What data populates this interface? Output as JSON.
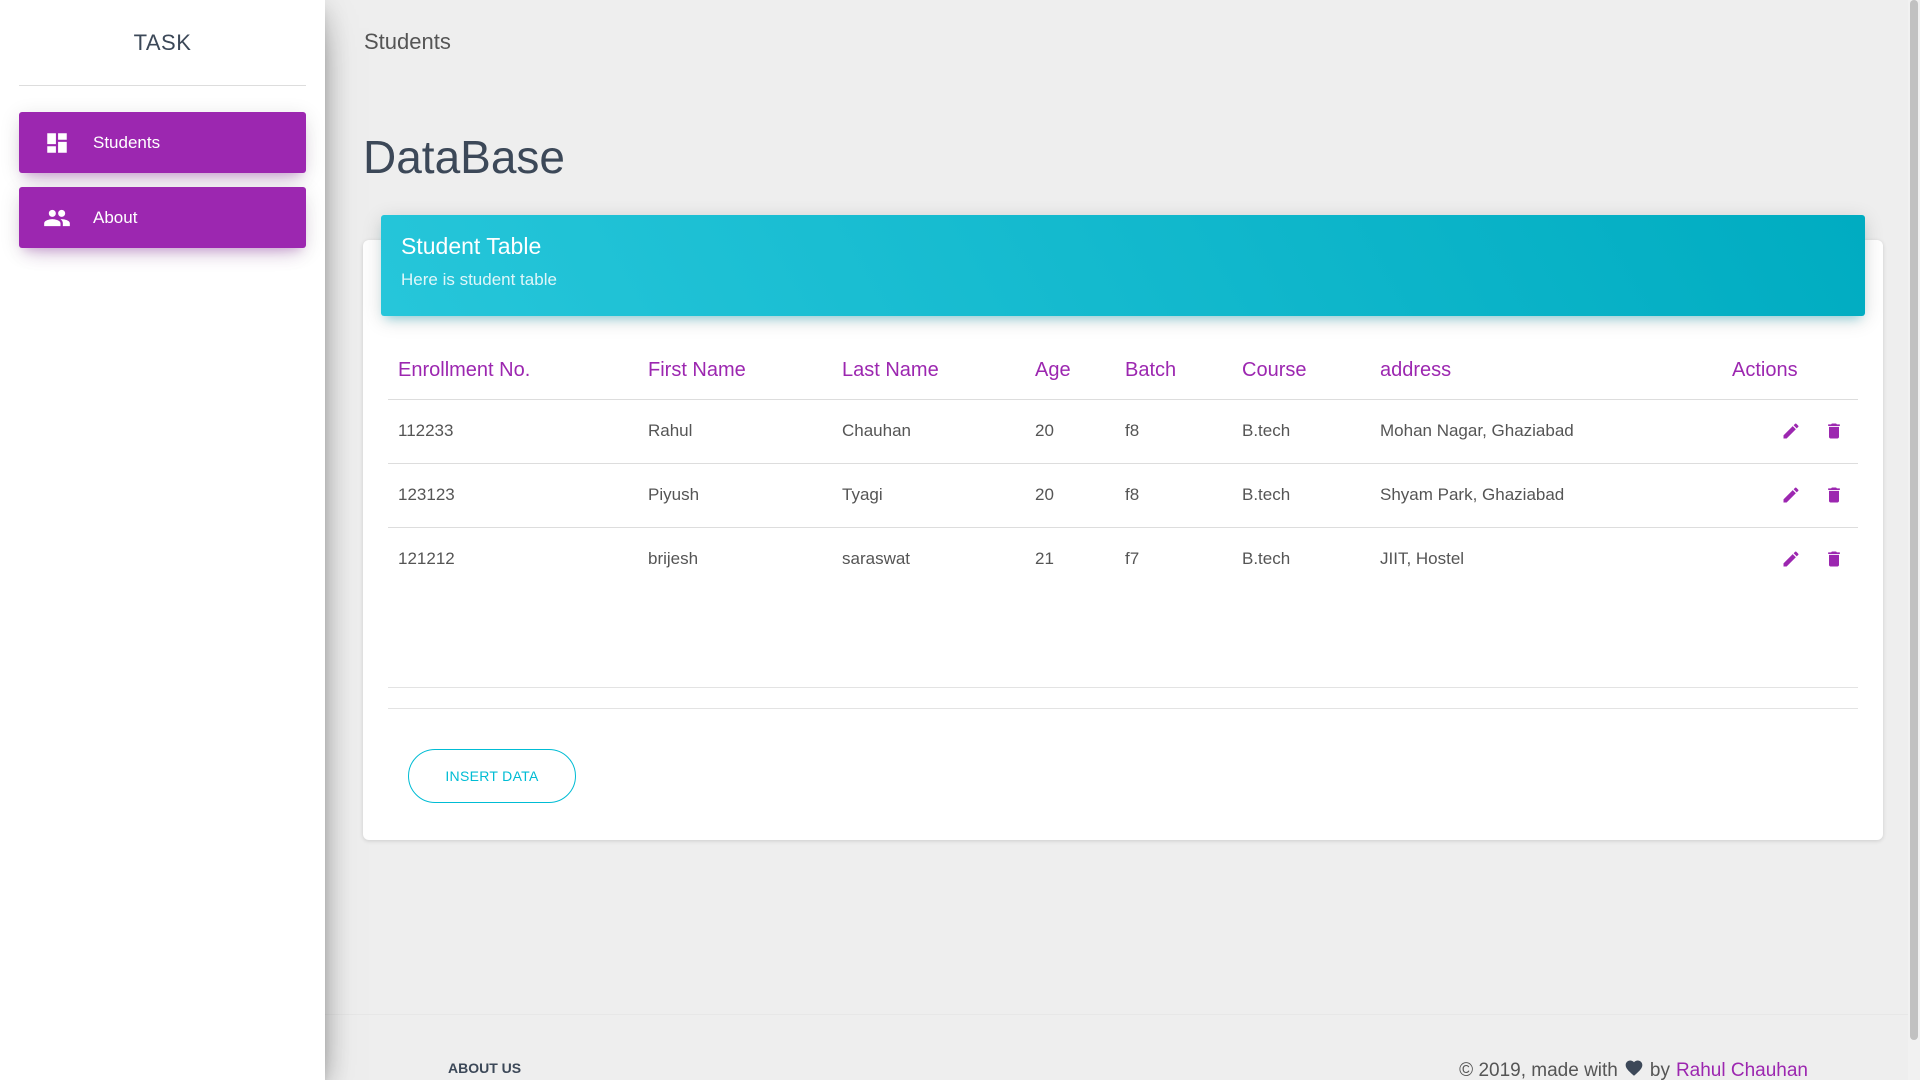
{
  "sidebar": {
    "brand": "TASK",
    "items": [
      {
        "label": "Students",
        "icon": "dashboard-icon"
      },
      {
        "label": "About",
        "icon": "people-icon"
      }
    ]
  },
  "topbar": {
    "title": "Students"
  },
  "page": {
    "title": "DataBase"
  },
  "card": {
    "title": "Student Table",
    "subtitle": "Here is student table",
    "insert_label": "INSERT DATA"
  },
  "table": {
    "headers": [
      "Enrollment No.",
      "First Name",
      "Last Name",
      "Age",
      "Batch",
      "Course",
      "address",
      "Actions"
    ],
    "rows": [
      [
        "112233",
        "Rahul",
        "Chauhan",
        "20",
        "f8",
        "B.tech",
        "Mohan Nagar, Ghaziabad"
      ],
      [
        "123123",
        "Piyush",
        "Tyagi",
        "20",
        "f8",
        "B.tech",
        "Shyam Park, Ghaziabad"
      ],
      [
        "121212",
        "brijesh",
        "saraswat",
        "21",
        "f7",
        "B.tech",
        "JIIT, Hostel"
      ]
    ]
  },
  "footer": {
    "link": "ABOUT US",
    "copyright_prefix": "© 2019, made with",
    "copyright_by": "by",
    "author": "Rahul Chauhan"
  },
  "colors": {
    "primary": "#9c27b0",
    "info": "#00bcd4",
    "background": "#eeeeee"
  }
}
